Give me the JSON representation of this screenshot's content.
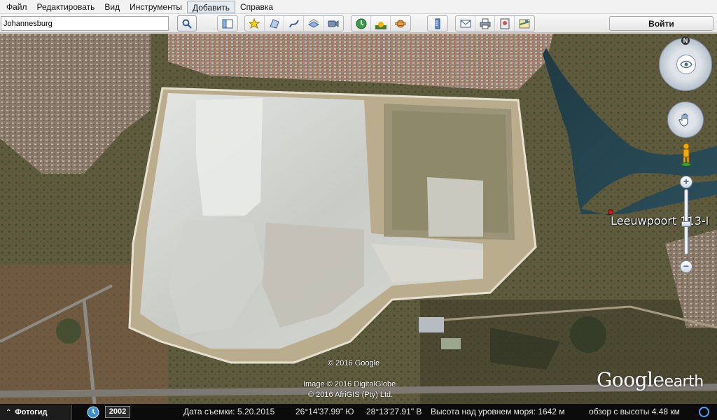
{
  "menu": {
    "items": [
      {
        "label": "Файл"
      },
      {
        "label": "Редактировать"
      },
      {
        "label": "Вид"
      },
      {
        "label": "Инструменты"
      },
      {
        "label": "Добавить"
      },
      {
        "label": "Справка"
      }
    ],
    "active_index": 4
  },
  "toolbar": {
    "search_value": "Johannesburg",
    "login_label": "Войти",
    "icons": {
      "search": "search-icon",
      "sidebar": "sidebar-toggle-icon",
      "placemark": "add-placemark-icon",
      "polygon": "add-polygon-icon",
      "path": "add-path-icon",
      "overlay": "image-overlay-icon",
      "tour": "record-tour-icon",
      "history": "historical-imagery-icon",
      "sunlight": "sunlight-icon",
      "planets": "planets-icon",
      "ruler": "ruler-icon",
      "email": "email-icon",
      "print": "print-icon",
      "save_image": "save-image-icon",
      "maps": "view-in-maps-icon"
    }
  },
  "map": {
    "placemark_label": "Leeuwpoort 113-I",
    "copyright_google": "© 2016 Google",
    "copyright_image": "Image © 2016 DigitalGlobe",
    "copyright_afrigis": "© 2016 AfriGIS (Pty) Ltd.",
    "logo_google": "Google",
    "logo_earth": "earth",
    "compass_north": "N"
  },
  "status": {
    "photo_tab": "Фотогид",
    "year": "2002",
    "capture_date": "Дата съемки: 5.20.2015",
    "latitude": "26°14'37.99\" Ю",
    "longitude": "28°13'27.91\" В",
    "altitude": "Высота над уровнем моря:  1642 м",
    "eye_altitude": "обзор с высоты   4.48 км"
  }
}
